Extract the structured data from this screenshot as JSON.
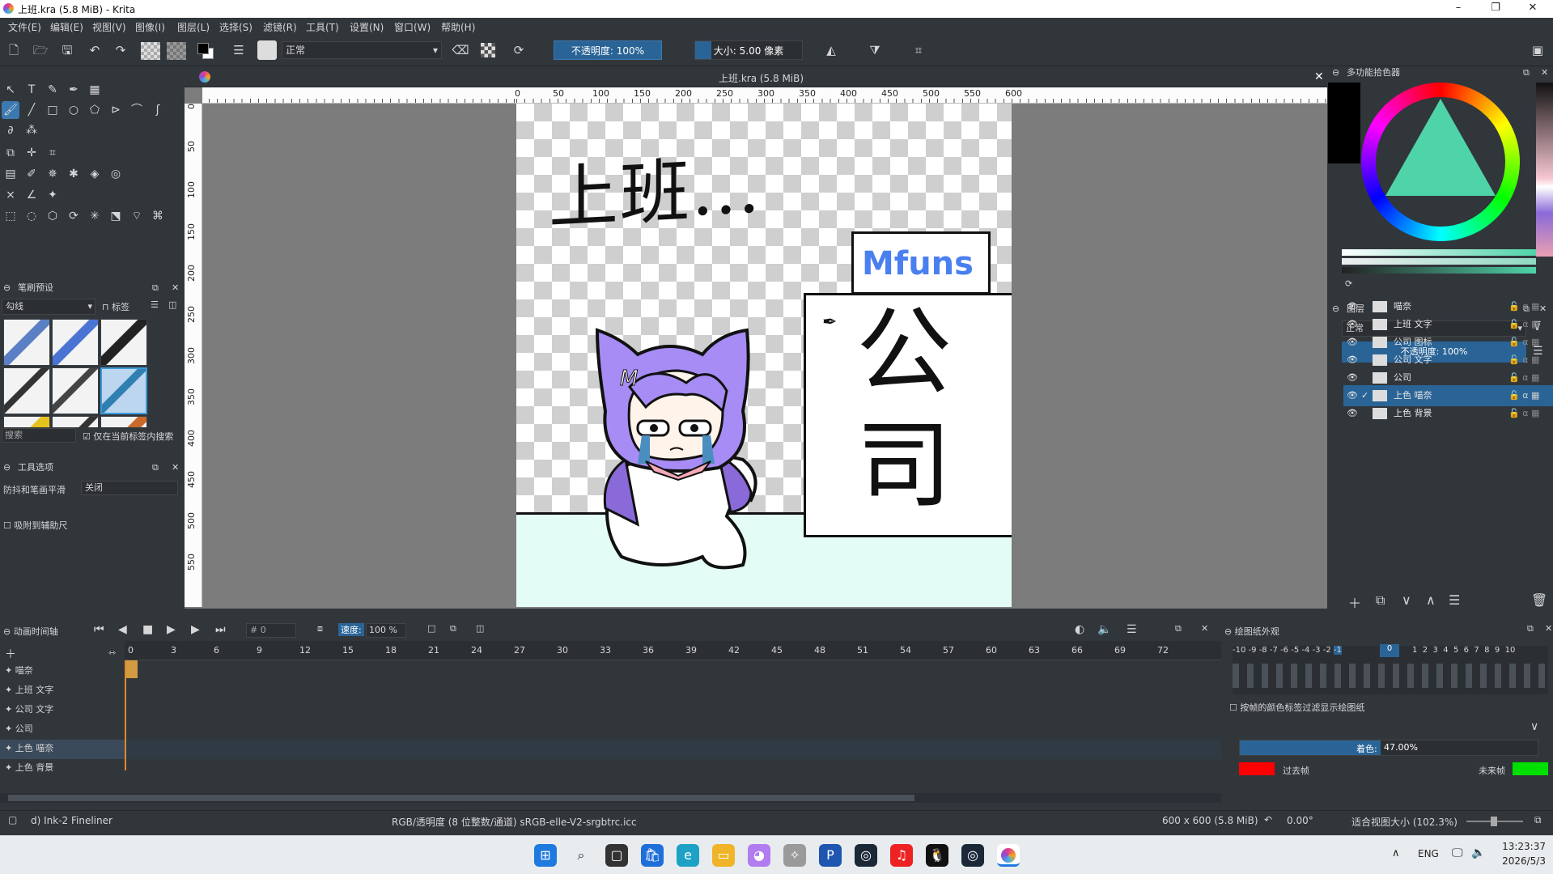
{
  "window": {
    "title": "上班.kra (5.8 MiB)  - Krita",
    "min": "–",
    "max": "❐",
    "close": "✕"
  },
  "menu": [
    "文件(E)",
    "编辑(E)",
    "视图(V)",
    "图像(I)",
    "图层(L)",
    "选择(S)",
    "滤镜(R)",
    "工具(T)",
    "设置(N)",
    "窗口(W)",
    "帮助(H)"
  ],
  "toolbar": {
    "blend_mode": "正常",
    "opacity": "不透明度: 100%",
    "size": "大小: 5.00 像素"
  },
  "document": {
    "tab_title": "上班.kra (5.8 MiB)",
    "close": "✕"
  },
  "ruler": {
    "h": [
      "0",
      "50",
      "100",
      "150",
      "200",
      "250",
      "300",
      "350",
      "400",
      "450",
      "500",
      "550",
      "600"
    ],
    "v": [
      "0",
      "50",
      "100",
      "150",
      "200",
      "250",
      "300",
      "350",
      "400",
      "450",
      "500",
      "550"
    ]
  },
  "artwork": {
    "text_main": "上班…",
    "sign_logo": "Mfuns",
    "sign_char": "公司",
    "badge": "M"
  },
  "brush_presets": {
    "title": "笔刷预设",
    "category": "勾线",
    "tag": "标签",
    "search": "搜索",
    "search_in_tag": "仅在当前标签内搜索"
  },
  "tool_options": {
    "title": "工具选项",
    "smoothing_label": "防抖和笔画平滑",
    "smoothing_value": "关闭",
    "snap": "吸附到辅助尺"
  },
  "color_selector": {
    "title": "多功能拾色器"
  },
  "layers": {
    "title": "图层",
    "blend": "正常",
    "opacity": "不透明度: 100%",
    "items": [
      {
        "name": "喵奈"
      },
      {
        "name": "上班 文字"
      },
      {
        "name": "公司 图标"
      },
      {
        "name": "公司 文字"
      },
      {
        "name": "公司"
      },
      {
        "name": "上色 喵奈",
        "selected": true
      },
      {
        "name": "上色 背景"
      }
    ]
  },
  "animation": {
    "title": "动画时间轴",
    "frame": "# 0",
    "speed_label": "速度:",
    "speed": "100 %",
    "frame_numbers": [
      "0",
      "3",
      "6",
      "9",
      "12",
      "15",
      "18",
      "21",
      "24",
      "27",
      "30",
      "33",
      "36",
      "39",
      "42",
      "45",
      "48",
      "51",
      "54",
      "57",
      "60",
      "63",
      "66",
      "69",
      "72"
    ],
    "layers": [
      "喵奈",
      "上班 文字",
      "公司 文字",
      "公司",
      "上色 喵奈",
      "上色 背景"
    ]
  },
  "onion": {
    "title": "绘图纸外观",
    "neg": [
      "-10",
      "-9",
      "-8",
      "-7",
      "-6",
      "-5",
      "-4",
      "-3",
      "-2",
      "-1"
    ],
    "zero": "0",
    "pos": [
      "1",
      "2",
      "3",
      "4",
      "5",
      "6",
      "7",
      "8",
      "9",
      "10"
    ],
    "filter_label": "按帧的颜色标签过滤显示绘图纸",
    "tint_label": "着色:",
    "tint_value": "47.00%",
    "prev": "过去帧",
    "next": "未来帧",
    "prev_color": "#ff0000",
    "next_color": "#00e000"
  },
  "status": {
    "brush": "d) Ink-2 Fineliner",
    "colorspace": "RGB/透明度 (8 位整数/通道)  sRGB-elle-V2-srgbtrc.icc",
    "dims": "600 x 600 (5.8 MiB)",
    "rotation": "0.00°",
    "zoom": "适合视图大小 (102.3%)"
  },
  "taskbar": {
    "lang": "ENG",
    "time": "13:23:37",
    "date": "2026/5/3"
  }
}
